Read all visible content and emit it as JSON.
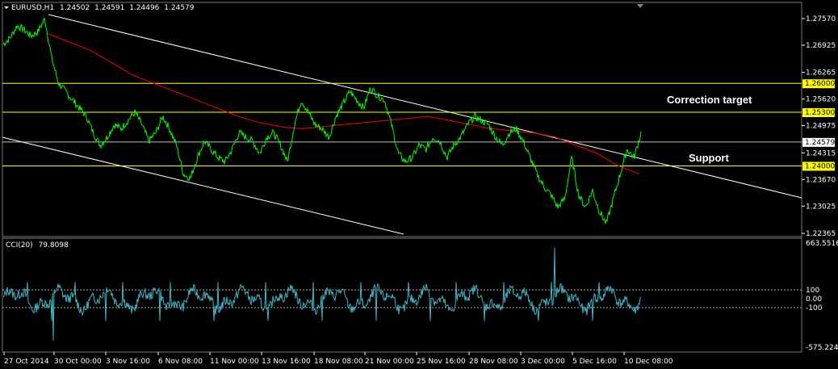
{
  "chart_data": [
    {
      "type": "line",
      "title": "EURUSD,H1",
      "ohlc": [
        "1.24502",
        "1.24591",
        "1.24496",
        "1.24579"
      ],
      "ylim": [
        1.22365,
        1.2757
      ],
      "y_ticks": [
        "1.27570",
        "1.26925",
        "1.26265",
        "1.25620",
        "1.24975",
        "1.24315",
        "1.23670",
        "1.23025",
        "1.22365"
      ],
      "x_tick_labels": [
        "27 Oct 2014",
        "30 Oct 00:00",
        "3 Nov 16:00",
        "6 Nov 08:00",
        "11 Nov 00:00",
        "13 Nov 16:00",
        "18 Nov 08:00",
        "21 Nov 00:00",
        "25 Nov 16:00",
        "28 Nov 08:00",
        "3 Dec 00:00",
        "5 Dec 16:00",
        "10 Dec 08:00"
      ],
      "horizontal_levels": [
        {
          "value": 1.26,
          "label": "1.26000",
          "color": "#ffff00"
        },
        {
          "value": 1.253,
          "label": "1.25300",
          "color": "#ffff00"
        },
        {
          "value": 1.24579,
          "label": "1.24579",
          "color": "#c0c0c0"
        },
        {
          "value": 1.24,
          "label": "1.24000",
          "color": "#ffff00"
        }
      ],
      "annotations": [
        "Correction target",
        "Support"
      ],
      "series": [
        {
          "values_x": [
            0,
            3,
            6,
            9,
            12,
            15,
            18,
            20,
            24,
            27,
            30,
            33,
            36,
            39,
            42,
            45,
            48,
            51,
            54,
            57,
            60,
            63,
            66,
            69,
            72,
            75,
            78,
            81,
            84,
            87,
            90,
            93,
            96,
            99,
            102,
            105,
            108,
            111,
            114,
            117,
            120,
            123,
            126,
            129,
            132,
            135,
            138,
            141,
            144,
            147,
            150,
            153,
            156,
            159,
            162,
            165,
            168,
            171,
            174,
            177,
            180,
            183,
            186,
            189,
            192,
            195,
            198,
            201,
            204,
            207,
            210,
            213,
            216,
            219,
            222,
            225,
            228,
            230,
            233,
            236,
            239,
            242,
            245,
            248,
            251,
            254,
            257,
            260,
            263,
            266,
            269,
            272,
            275
          ],
          "values": [
            1.2695,
            1.271,
            1.274,
            1.273,
            1.2715,
            1.2725,
            1.2757,
            1.266,
            1.26,
            1.258,
            1.256,
            1.254,
            1.252,
            1.248,
            1.245,
            1.247,
            1.25,
            1.249,
            1.251,
            1.253,
            1.25,
            1.246,
            1.248,
            1.252,
            1.249,
            1.245,
            1.238,
            1.237,
            1.242,
            1.246,
            1.244,
            1.242,
            1.241,
            1.244,
            1.248,
            1.247,
            1.246,
            1.243,
            1.247,
            1.248,
            1.245,
            1.241,
            1.25,
            1.256,
            1.253,
            1.25,
            1.249,
            1.247,
            1.252,
            1.255,
            1.258,
            1.256,
            1.254,
            1.259,
            1.257,
            1.256,
            1.25,
            1.243,
            1.241,
            1.242,
            1.245,
            1.244,
            1.247,
            1.246,
            1.242,
            1.245,
            1.247,
            1.25,
            1.252,
            1.251,
            1.25,
            1.247,
            1.245,
            1.248,
            1.249,
            1.246,
            1.242,
            1.238,
            1.235,
            1.233,
            1.23,
            1.232,
            1.242,
            1.233,
            1.23,
            1.234,
            1.229,
            1.226,
            1.232,
            1.238,
            1.244,
            1.242,
            1.248
          ],
          "name": ""
        },
        {
          "name": "",
          "values": [
            1.272,
            1.27,
            1.268,
            1.265,
            1.262,
            1.26,
            1.258,
            1.256,
            1.254,
            1.252,
            1.2505,
            1.2495,
            1.249,
            1.2495,
            1.25,
            1.2505,
            1.251,
            1.2515,
            1.252,
            1.251,
            1.25,
            1.249,
            1.2485,
            1.248,
            1.247,
            1.245,
            1.243,
            1.24,
            1.238
          ]
        }
      ]
    },
    {
      "type": "line",
      "title": "CCI(20)",
      "value_label": "79.8098",
      "ylim": [
        -575.2247,
        663.5516
      ],
      "y_ticks": [
        "663.5516",
        "100",
        "0.00",
        "-100",
        "-575.2247"
      ],
      "levels": [
        100,
        -100
      ]
    }
  ],
  "colors": {
    "background": "#000000",
    "price": "#00ff00",
    "ma": "#ff0000",
    "cci": "#3fb7c8",
    "level": "#ffff00",
    "channel": "#ffffff"
  }
}
